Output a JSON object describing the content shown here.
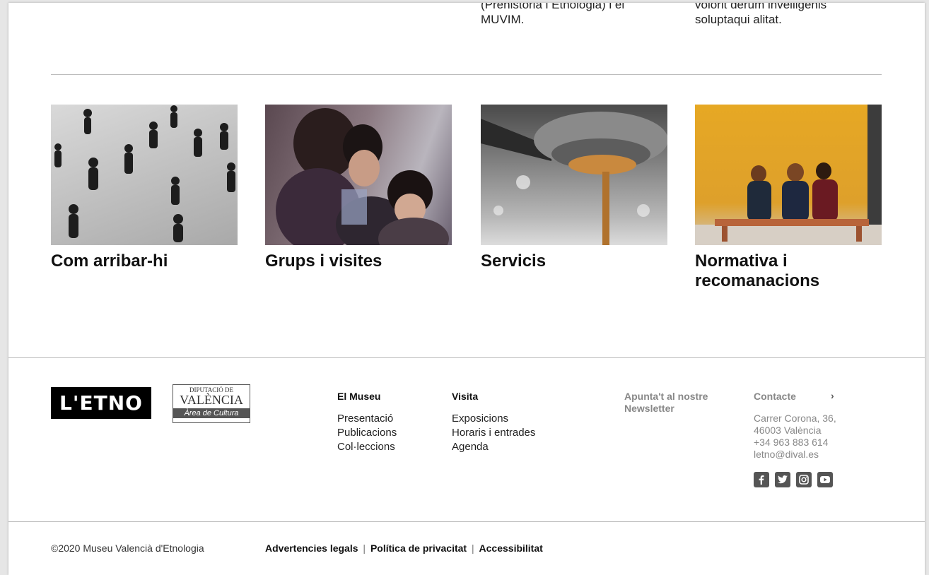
{
  "intro": {
    "col3_text": "(Prehistòria i Etnologia) i el MUVIM.",
    "col4_text": "volorit derum invelligenis soluptaqui alitat."
  },
  "cards": [
    {
      "title": "Com arribar-hi"
    },
    {
      "title": "Grups i visites"
    },
    {
      "title": "Servicis"
    },
    {
      "title": "Normativa i recomanacions"
    }
  ],
  "footer": {
    "logo_text": "L'ETNO",
    "dipu_line1": "DIPUTACIÓ DE",
    "dipu_line2": "VALÈNCIA",
    "dipu_line3": "Àrea de Cultura",
    "museu": {
      "heading": "El Museu",
      "links": [
        "Presentació",
        "Publicacions",
        "Col·leccions"
      ]
    },
    "visita": {
      "heading": "Visita",
      "links": [
        "Exposicions",
        "Horaris i entrades",
        "Agenda"
      ]
    },
    "newsletter": "Apunta't al nostre Newsletter",
    "contacte": {
      "heading": "Contacte",
      "arrow": "›",
      "address1": "Carrer Corona, 36,",
      "address2": "46003 València",
      "phone": "+34 963 883 614",
      "email": "letno@dival.es"
    },
    "social": [
      "facebook-icon",
      "twitter-icon",
      "instagram-icon",
      "youtube-icon"
    ]
  },
  "bottom": {
    "copyright": "©2020 Museu Valencià d'Etnologia",
    "legal": "Advertencies legals",
    "privacy": "Política de privacitat",
    "access": "Accessibilitat",
    "sep": "|"
  }
}
